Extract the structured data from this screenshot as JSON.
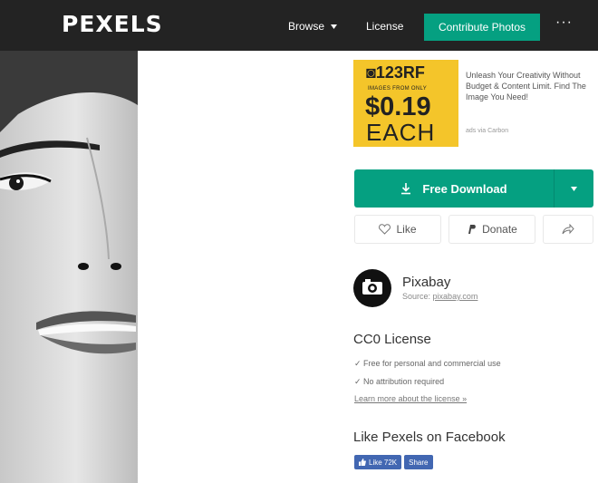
{
  "header": {
    "logo": "PEXELS",
    "browse_label": "Browse",
    "license_label": "License",
    "contribute_label": "Contribute Photos",
    "more_label": "···"
  },
  "ad": {
    "brand": "123RF",
    "tagline": "IMAGES FROM ONLY",
    "price": "$0.19",
    "unit": "EACH",
    "text": "Unleash Your Creativity Without Budget & Content Limit. Find The Image You Need!",
    "via": "ads via Carbon"
  },
  "actions": {
    "download_label": "Free Download",
    "like_label": "Like",
    "donate_label": "Donate"
  },
  "author": {
    "name": "Pixabay",
    "source_prefix": "Source:",
    "source_link": "pixabay.com"
  },
  "license": {
    "title": "CC0 License",
    "line1": "✓ Free for personal and commercial use",
    "line2": "✓ No attribution required",
    "link": "Learn more about the license »"
  },
  "facebook": {
    "title": "Like Pexels on Facebook",
    "like_label": "Like 72K",
    "share_label": "Share"
  },
  "colors": {
    "brand_green": "#05a081",
    "topbar": "#232323",
    "ad_yellow": "#f4c52a",
    "facebook_blue": "#4267b2"
  }
}
